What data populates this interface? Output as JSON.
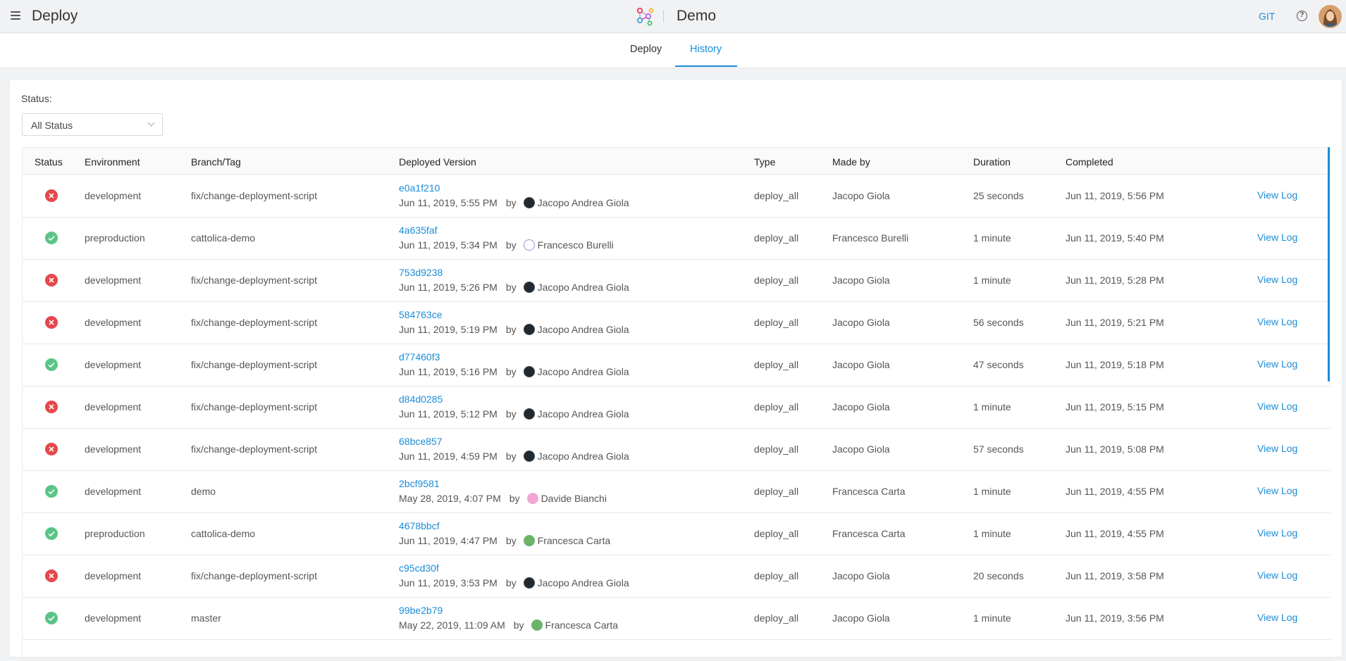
{
  "header": {
    "app_title": "Deploy",
    "project_name": "Demo",
    "git_label": "GIT",
    "help_symbol": "?",
    "icons": {
      "menu": "hamburger-menu-icon",
      "logo": "graph-logo-icon",
      "help": "help-icon",
      "avatar": "user-avatar"
    }
  },
  "tabs": [
    {
      "label": "Deploy",
      "active": false
    },
    {
      "label": "History",
      "active": true
    }
  ],
  "filter": {
    "label": "Status:",
    "selected": "All Status"
  },
  "table": {
    "columns": [
      "Status",
      "Environment",
      "Branch/Tag",
      "Deployed Version",
      "Type",
      "Made by",
      "Duration",
      "Completed"
    ],
    "view_log_label": "View Log",
    "by_label": "by",
    "rows": [
      {
        "status": "failed",
        "environment": "development",
        "branch": "fix/change-deployment-script",
        "hash": "e0a1f210",
        "date": "Jun 11, 2019, 5:55 PM",
        "author": "Jacopo Andrea Giola",
        "author_avatar": "dark",
        "type": "deploy_all",
        "made_by": "Jacopo Giola",
        "duration": "25 seconds",
        "completed": "Jun 11, 2019, 5:56 PM"
      },
      {
        "status": "success",
        "environment": "preproduction",
        "branch": "cattolica-demo",
        "hash": "4a635faf",
        "date": "Jun 11, 2019, 5:34 PM",
        "author": "Francesco Burelli",
        "author_avatar": "purple",
        "type": "deploy_all",
        "made_by": "Francesco Burelli",
        "duration": "1 minute",
        "completed": "Jun 11, 2019, 5:40 PM"
      },
      {
        "status": "failed",
        "environment": "development",
        "branch": "fix/change-deployment-script",
        "hash": "753d9238",
        "date": "Jun 11, 2019, 5:26 PM",
        "author": "Jacopo Andrea Giola",
        "author_avatar": "dark",
        "type": "deploy_all",
        "made_by": "Jacopo Giola",
        "duration": "1 minute",
        "completed": "Jun 11, 2019, 5:28 PM"
      },
      {
        "status": "failed",
        "environment": "development",
        "branch": "fix/change-deployment-script",
        "hash": "584763ce",
        "date": "Jun 11, 2019, 5:19 PM",
        "author": "Jacopo Andrea Giola",
        "author_avatar": "dark",
        "type": "deploy_all",
        "made_by": "Jacopo Giola",
        "duration": "56 seconds",
        "completed": "Jun 11, 2019, 5:21 PM"
      },
      {
        "status": "success",
        "environment": "development",
        "branch": "fix/change-deployment-script",
        "hash": "d77460f3",
        "date": "Jun 11, 2019, 5:16 PM",
        "author": "Jacopo Andrea Giola",
        "author_avatar": "dark",
        "type": "deploy_all",
        "made_by": "Jacopo Giola",
        "duration": "47 seconds",
        "completed": "Jun 11, 2019, 5:18 PM"
      },
      {
        "status": "failed",
        "environment": "development",
        "branch": "fix/change-deployment-script",
        "hash": "d84d0285",
        "date": "Jun 11, 2019, 5:12 PM",
        "author": "Jacopo Andrea Giola",
        "author_avatar": "dark",
        "type": "deploy_all",
        "made_by": "Jacopo Giola",
        "duration": "1 minute",
        "completed": "Jun 11, 2019, 5:15 PM"
      },
      {
        "status": "failed",
        "environment": "development",
        "branch": "fix/change-deployment-script",
        "hash": "68bce857",
        "date": "Jun 11, 2019, 4:59 PM",
        "author": "Jacopo Andrea Giola",
        "author_avatar": "dark",
        "type": "deploy_all",
        "made_by": "Jacopo Giola",
        "duration": "57 seconds",
        "completed": "Jun 11, 2019, 5:08 PM"
      },
      {
        "status": "success",
        "environment": "development",
        "branch": "demo",
        "hash": "2bcf9581",
        "date": "May 28, 2019, 4:07 PM",
        "author": "Davide Bianchi",
        "author_avatar": "pink",
        "type": "deploy_all",
        "made_by": "Francesca Carta",
        "duration": "1 minute",
        "completed": "Jun 11, 2019, 4:55 PM"
      },
      {
        "status": "success",
        "environment": "preproduction",
        "branch": "cattolica-demo",
        "hash": "4678bbcf",
        "date": "Jun 11, 2019, 4:47 PM",
        "author": "Francesca Carta",
        "author_avatar": "green",
        "type": "deploy_all",
        "made_by": "Francesca Carta",
        "duration": "1 minute",
        "completed": "Jun 11, 2019, 4:55 PM"
      },
      {
        "status": "failed",
        "environment": "development",
        "branch": "fix/change-deployment-script",
        "hash": "c95cd30f",
        "date": "Jun 11, 2019, 3:53 PM",
        "author": "Jacopo Andrea Giola",
        "author_avatar": "dark",
        "type": "deploy_all",
        "made_by": "Jacopo Giola",
        "duration": "20 seconds",
        "completed": "Jun 11, 2019, 3:58 PM"
      },
      {
        "status": "success",
        "environment": "development",
        "branch": "master",
        "hash": "99be2b79",
        "date": "May 22, 2019, 11:09 AM",
        "author": "Francesca Carta",
        "author_avatar": "green",
        "type": "deploy_all",
        "made_by": "Jacopo Giola",
        "duration": "1 minute",
        "completed": "Jun 11, 2019, 3:56 PM"
      }
    ]
  },
  "colors": {
    "accent": "#1a8cd8",
    "failed": "#e5484d",
    "success": "#5ac487"
  }
}
